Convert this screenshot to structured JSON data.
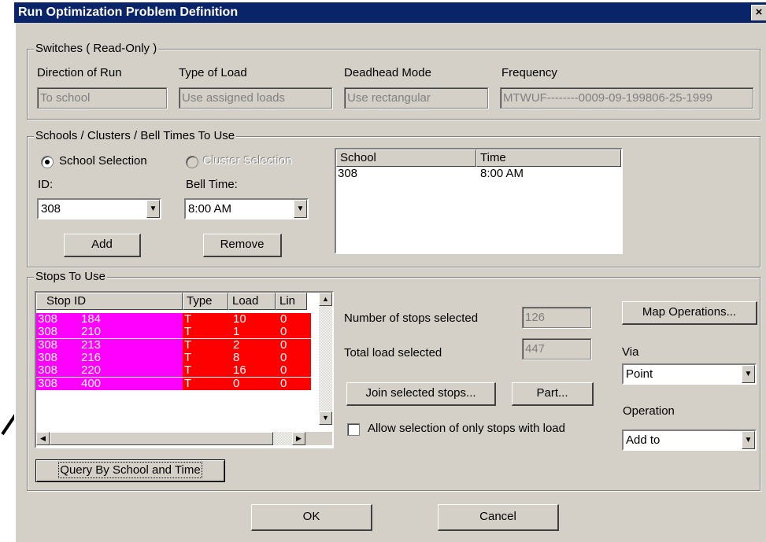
{
  "window": {
    "title": "Run Optimization Problem Definition",
    "close_glyph": "×"
  },
  "switches": {
    "group_label": "Switches ( Read-Only )",
    "direction": {
      "label": "Direction of Run",
      "value": "To school"
    },
    "load_type": {
      "label": "Type of Load",
      "value": "Use assigned loads"
    },
    "deadhead": {
      "label": "Deadhead Mode",
      "value": "Use rectangular"
    },
    "frequency": {
      "label": "Frequency",
      "value": "MTWUF--------0009-09-199806-25-1999"
    }
  },
  "schools": {
    "group_label": "Schools / Clusters / Bell Times To Use",
    "school_selection_label": "School Selection",
    "cluster_selection_label": "Cluster Selection",
    "id_label": "ID:",
    "id_value": "308",
    "bell_time_label": "Bell Time:",
    "bell_time_value": "8:00 AM",
    "add_label": "Add",
    "remove_label": "Remove",
    "table": {
      "columns": [
        "School",
        "Time"
      ],
      "rows": [
        {
          "school": "308",
          "time": "8:00 AM"
        }
      ]
    }
  },
  "stops": {
    "group_label": "Stops To Use",
    "columns": [
      "Stop ID",
      "Type",
      "Load",
      "Lin"
    ],
    "rows": [
      {
        "school": "308",
        "stop": "184",
        "type": "T",
        "load": "10",
        "lin": "0"
      },
      {
        "school": "308",
        "stop": "210",
        "type": "T",
        "load": "1",
        "lin": "0"
      },
      {
        "school": "308",
        "stop": "213",
        "type": "T",
        "load": "2",
        "lin": "0"
      },
      {
        "school": "308",
        "stop": "216",
        "type": "T",
        "load": "8",
        "lin": "0"
      },
      {
        "school": "308",
        "stop": "220",
        "type": "T",
        "load": "16",
        "lin": "0"
      },
      {
        "school": "308",
        "stop": "400",
        "type": "T",
        "load": "0",
        "lin": "0"
      }
    ],
    "row_colors": {
      "id_bg": "#ff00ff",
      "data_bg": "#ff0000",
      "text": "#ffffff"
    },
    "num_selected_label": "Number of stops selected",
    "num_selected_value": "126",
    "total_load_label": "Total load selected",
    "total_load_value": "447",
    "map_operations_label": "Map Operations...",
    "via_label": "Via",
    "via_value": "Point",
    "operation_label": "Operation",
    "operation_value": "Add to",
    "join_label": "Join selected stops...",
    "part_label": "Part...",
    "allow_label": "Allow selection of only stops with load",
    "query_label": "Query By School and Time"
  },
  "footer": {
    "ok_label": "OK",
    "cancel_label": "Cancel"
  },
  "colors": {
    "title_bar": "#0a246a",
    "dialog_bg": "#d4d0c8"
  }
}
